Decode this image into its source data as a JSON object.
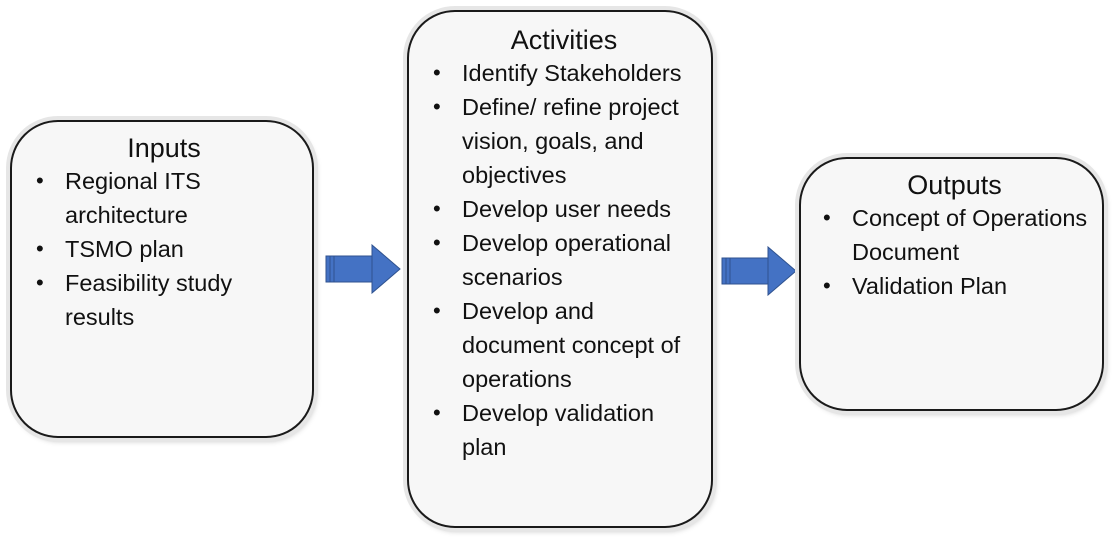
{
  "diagram": {
    "boxes": {
      "inputs": {
        "title": "Inputs",
        "items": [
          "Regional ITS architecture",
          "TSMO plan",
          "Feasibility study results"
        ]
      },
      "activities": {
        "title": "Activities",
        "items": [
          "Identify Stakeholders",
          "Define/ refine project vision, goals, and objectives",
          "Develop user needs",
          "Develop operational scenarios",
          "Develop and document concept of operations",
          "Develop validation plan"
        ]
      },
      "outputs": {
        "title": "Outputs",
        "items": [
          "Concept of Operations Document",
          "Validation Plan"
        ]
      }
    },
    "bullet_glyph": "•",
    "arrow_color": "#4472c4",
    "arrow_border_color": "#2f528f",
    "flow": [
      "inputs",
      "activities",
      "outputs"
    ]
  }
}
